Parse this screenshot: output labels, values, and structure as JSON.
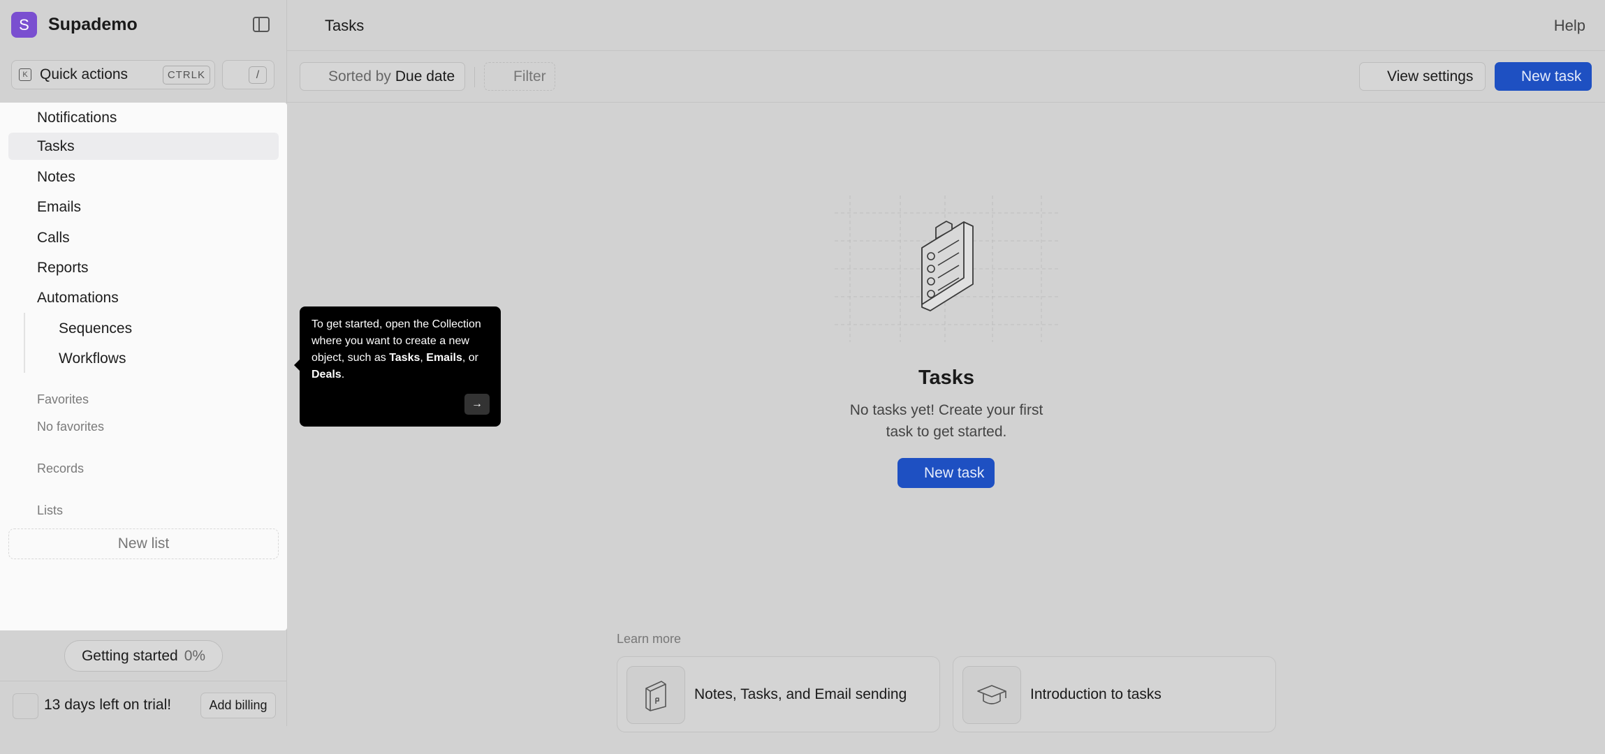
{
  "brand": {
    "logo_letter": "S",
    "name": "Supademo"
  },
  "quick_actions": {
    "label": "Quick actions",
    "shortcut": "CTRLK",
    "slash": "/"
  },
  "nav": {
    "items": [
      {
        "label": "Notifications"
      },
      {
        "label": "Tasks"
      },
      {
        "label": "Notes"
      },
      {
        "label": "Emails"
      },
      {
        "label": "Calls"
      },
      {
        "label": "Reports"
      },
      {
        "label": "Automations"
      }
    ],
    "sub_items": [
      {
        "label": "Sequences"
      },
      {
        "label": "Workflows"
      }
    ],
    "favorites_label": "Favorites",
    "no_favorites": "No favorites",
    "records_label": "Records",
    "lists_label": "Lists",
    "new_list": "New list"
  },
  "getting_started": {
    "label": "Getting started",
    "percent": "0%"
  },
  "trial": {
    "text": "13 days left on trial!",
    "billing_button": "Add billing"
  },
  "header": {
    "title": "Tasks",
    "help": "Help"
  },
  "toolbar": {
    "sort_prefix": "Sorted by",
    "sort_value": "Due date",
    "filter": "Filter",
    "view_settings": "View settings",
    "new_task": "New task"
  },
  "empty_state": {
    "title": "Tasks",
    "description": "No tasks yet! Create your first task to get started.",
    "button": "New task"
  },
  "learn_more": {
    "label": "Learn more",
    "cards": [
      {
        "title": "Notes, Tasks, and Email sending",
        "icon": "book-icon"
      },
      {
        "title": "Introduction to tasks",
        "icon": "graduation-cap-icon"
      }
    ]
  },
  "tooltip": {
    "text_intro": "To get started, open the Collection where you want to create a new object, such as",
    "tasks": "Tasks",
    "comma": ",",
    "emails": "Emails",
    "or": ", or",
    "deals": "Deals",
    "period": ".",
    "next_icon": "arrow-right-icon"
  },
  "colors": {
    "accent": "#1e50c2",
    "brand": "#7a4fd0",
    "background": "#d2d2d2",
    "panel": "#fafafa"
  }
}
